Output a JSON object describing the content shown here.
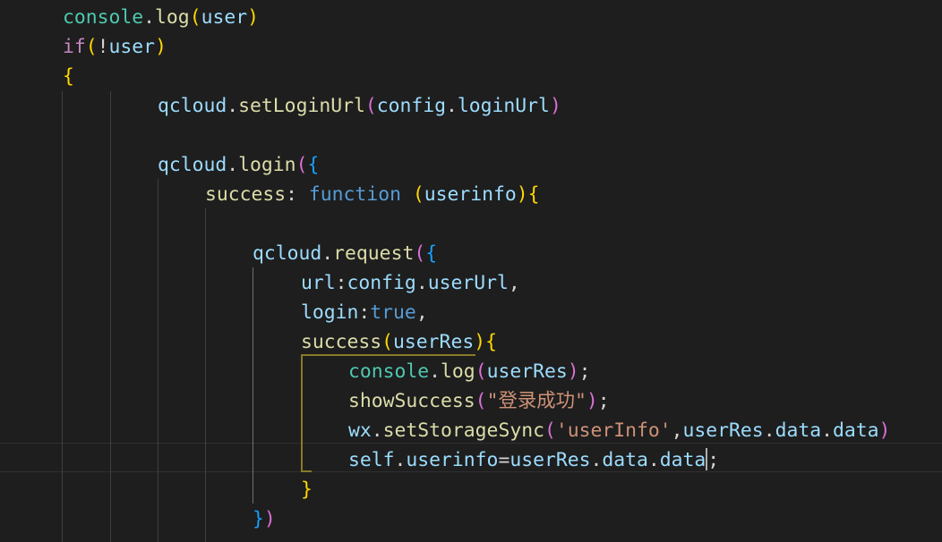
{
  "editor": {
    "language": "javascript",
    "cursor_line": 16,
    "lines": [
      {
        "tokens": [
          {
            "t": "console",
            "c": "teal"
          },
          {
            "t": ".",
            "c": "pl"
          },
          {
            "t": "log",
            "c": "fn"
          },
          {
            "t": "(",
            "c": "p1"
          },
          {
            "t": "user",
            "c": "var"
          },
          {
            "t": ")",
            "c": "p1"
          }
        ]
      },
      {
        "tokens": [
          {
            "t": "if",
            "c": "kw"
          },
          {
            "t": "(",
            "c": "p1"
          },
          {
            "t": "!",
            "c": "pl"
          },
          {
            "t": "user",
            "c": "var"
          },
          {
            "t": ")",
            "c": "p1"
          }
        ]
      },
      {
        "tokens": [
          {
            "t": "{",
            "c": "p1"
          }
        ]
      },
      {
        "tokens": [
          {
            "t": "qcloud",
            "c": "var"
          },
          {
            "t": ".",
            "c": "pl"
          },
          {
            "t": "setLoginUrl",
            "c": "fn"
          },
          {
            "t": "(",
            "c": "p2"
          },
          {
            "t": "config",
            "c": "var"
          },
          {
            "t": ".",
            "c": "pl"
          },
          {
            "t": "loginUrl",
            "c": "var"
          },
          {
            "t": ")",
            "c": "p2"
          }
        ]
      },
      {
        "tokens": []
      },
      {
        "tokens": [
          {
            "t": "qcloud",
            "c": "var"
          },
          {
            "t": ".",
            "c": "pl"
          },
          {
            "t": "login",
            "c": "fn"
          },
          {
            "t": "(",
            "c": "p2"
          },
          {
            "t": "{",
            "c": "p3"
          }
        ]
      },
      {
        "tokens": [
          {
            "t": "success",
            "c": "fn"
          },
          {
            "t": ": ",
            "c": "pl"
          },
          {
            "t": "function",
            "c": "kwb"
          },
          {
            "t": " ",
            "c": "pl"
          },
          {
            "t": "(",
            "c": "p1"
          },
          {
            "t": "userinfo",
            "c": "var"
          },
          {
            "t": ")",
            "c": "p1"
          },
          {
            "t": "{",
            "c": "p1"
          }
        ]
      },
      {
        "tokens": []
      },
      {
        "tokens": [
          {
            "t": "qcloud",
            "c": "var"
          },
          {
            "t": ".",
            "c": "pl"
          },
          {
            "t": "request",
            "c": "fn"
          },
          {
            "t": "(",
            "c": "p2"
          },
          {
            "t": "{",
            "c": "p3"
          }
        ]
      },
      {
        "tokens": [
          {
            "t": "url",
            "c": "var"
          },
          {
            "t": ":",
            "c": "pl"
          },
          {
            "t": "config",
            "c": "var"
          },
          {
            "t": ".",
            "c": "pl"
          },
          {
            "t": "userUrl",
            "c": "var"
          },
          {
            "t": ",",
            "c": "pl"
          }
        ]
      },
      {
        "tokens": [
          {
            "t": "login",
            "c": "var"
          },
          {
            "t": ":",
            "c": "pl"
          },
          {
            "t": "true",
            "c": "kwb"
          },
          {
            "t": ",",
            "c": "pl"
          }
        ]
      },
      {
        "tokens": [
          {
            "t": "success",
            "c": "fn"
          },
          {
            "t": "(",
            "c": "p1"
          },
          {
            "t": "userRes",
            "c": "var"
          },
          {
            "t": ")",
            "c": "p1"
          },
          {
            "t": "{",
            "c": "p1"
          }
        ]
      },
      {
        "tokens": [
          {
            "t": "console",
            "c": "teal"
          },
          {
            "t": ".",
            "c": "pl"
          },
          {
            "t": "log",
            "c": "fn"
          },
          {
            "t": "(",
            "c": "p2"
          },
          {
            "t": "userRes",
            "c": "var"
          },
          {
            "t": ")",
            "c": "p2"
          },
          {
            "t": ";",
            "c": "pl"
          }
        ]
      },
      {
        "tokens": [
          {
            "t": "showSuccess",
            "c": "fn"
          },
          {
            "t": "(",
            "c": "p2"
          },
          {
            "t": "\"登录成功\"",
            "c": "str"
          },
          {
            "t": ")",
            "c": "p2"
          },
          {
            "t": ";",
            "c": "pl"
          }
        ]
      },
      {
        "tokens": [
          {
            "t": "wx",
            "c": "var"
          },
          {
            "t": ".",
            "c": "pl"
          },
          {
            "t": "setStorageSync",
            "c": "fn"
          },
          {
            "t": "(",
            "c": "p2"
          },
          {
            "t": "'userInfo'",
            "c": "str"
          },
          {
            "t": ",",
            "c": "pl"
          },
          {
            "t": "userRes",
            "c": "var"
          },
          {
            "t": ".",
            "c": "pl"
          },
          {
            "t": "data",
            "c": "var"
          },
          {
            "t": ".",
            "c": "pl"
          },
          {
            "t": "data",
            "c": "var"
          },
          {
            "t": ")",
            "c": "p2"
          }
        ]
      },
      {
        "tokens": [
          {
            "t": "self",
            "c": "var"
          },
          {
            "t": ".",
            "c": "pl"
          },
          {
            "t": "userinfo",
            "c": "var"
          },
          {
            "t": "=",
            "c": "pl"
          },
          {
            "t": "userRes",
            "c": "var"
          },
          {
            "t": ".",
            "c": "pl"
          },
          {
            "t": "data",
            "c": "var"
          },
          {
            "t": ".",
            "c": "pl"
          },
          {
            "t": "data",
            "c": "var"
          },
          {
            "t": ";",
            "c": "pl"
          }
        ]
      },
      {
        "tokens": [
          {
            "t": "}",
            "c": "p1"
          }
        ]
      },
      {
        "tokens": [
          {
            "t": "}",
            "c": "p3"
          },
          {
            "t": ")",
            "c": "p2"
          }
        ]
      }
    ]
  }
}
